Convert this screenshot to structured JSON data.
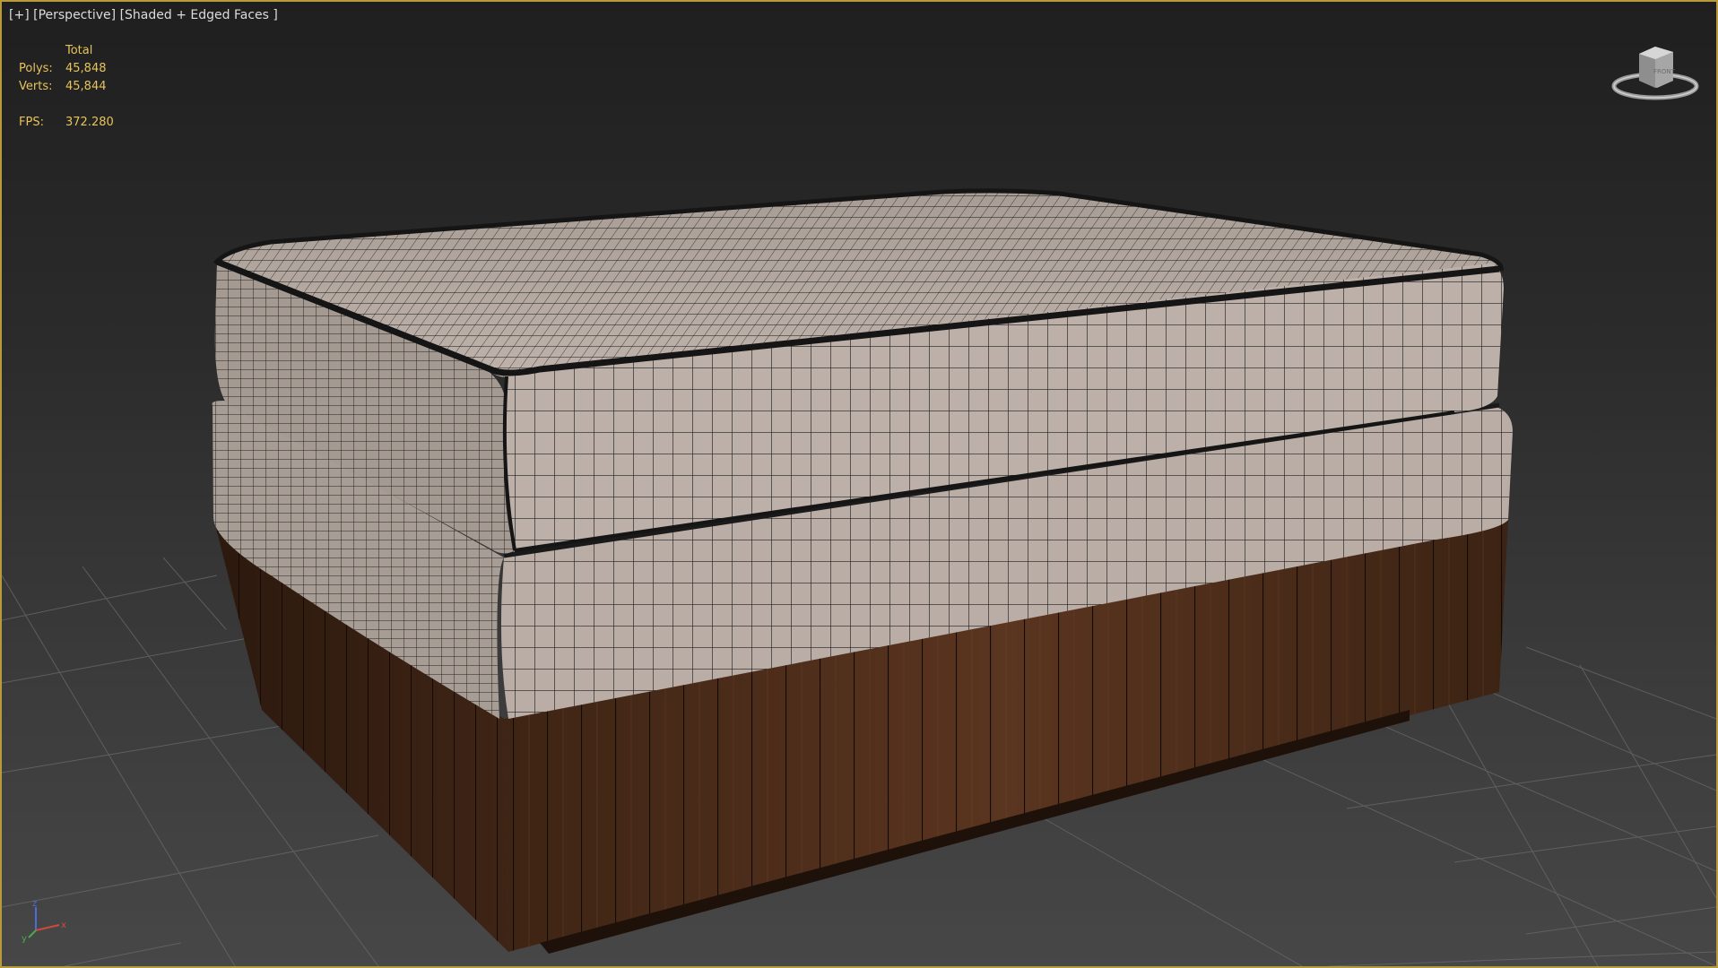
{
  "viewport": {
    "menu_label": "[+]",
    "view_label": "[Perspective]",
    "shading_label": "[Shaded + Edged Faces ]"
  },
  "stats": {
    "header": "Total",
    "polys_label": "Polys:",
    "polys_value": "45,848",
    "verts_label": "Verts:",
    "verts_value": "45,844",
    "fps_label": "FPS:",
    "fps_value": "372.280"
  },
  "viewcube": {
    "icon": "viewcube-icon",
    "face_label": "FRONT"
  },
  "axis_tripod": {
    "z_label": "z",
    "x_label": "x",
    "y_label": "y"
  },
  "colors": {
    "active_viewport_border": "#b89a3c",
    "stats_text": "#e6c35c",
    "fabric": "#b6aaa2",
    "wood": "#4a2c1a"
  }
}
